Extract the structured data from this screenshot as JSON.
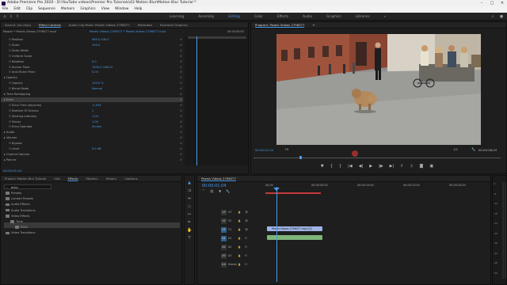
{
  "window": {
    "title": "Adobe Premiere Pro 2020 - D:\\YouTube videos\\Premier Pro Tutorials\\42 Motion Blur\\Motion Blur Tutorial *",
    "controls": [
      "–",
      "□",
      "✕"
    ]
  },
  "menu": [
    "File",
    "Edit",
    "Clip",
    "Sequence",
    "Markers",
    "Graphics",
    "View",
    "Window",
    "Help"
  ],
  "workspaces": {
    "tabs": [
      "Learning",
      "Assembly",
      "Editing",
      "Color",
      "Effects",
      "Audio",
      "Graphics",
      "Libraries"
    ],
    "active": "Editing",
    "more": "»"
  },
  "source_panel": {
    "tabs": [
      "Source: (no clips)",
      "Effect Controls",
      "Audio Clip Mixer: Pexels Videos 2796077",
      "Metadata",
      "Essential Graphics"
    ],
    "active_tab": "Effect Controls",
    "master_label": "Master * Pexels Videos 2796077.mp4",
    "clip_label": "Pexels Videos 2796077 * Pexels Videos 2796077.mp4",
    "ruler_time": "00:00:05:00",
    "rows": [
      {
        "label": "Position",
        "value": "960.0   540.0"
      },
      {
        "label": "Scale",
        "value": "100.0"
      },
      {
        "label": "Scale Width",
        "value": ""
      },
      {
        "label": "Uniform Scale",
        "value": ""
      },
      {
        "label": "Rotation",
        "value": "0.0"
      },
      {
        "label": "Anchor Point",
        "value": "1920.0   1080.0"
      },
      {
        "label": "Anti-flicker Filter",
        "value": "0.00"
      },
      {
        "label": "Opacity",
        "value": ""
      },
      {
        "label": "Opacity",
        "value": "100.0 %"
      },
      {
        "label": "Blend Mode",
        "value": "Normal"
      },
      {
        "label": "Time Remapping",
        "value": ""
      },
      {
        "label": "Echo",
        "value": ""
      },
      {
        "label": "Echo Time (seconds)",
        "value": "-0.033"
      },
      {
        "label": "Number Of Echoes",
        "value": "1"
      },
      {
        "label": "Starting Intensity",
        "value": "1.00"
      },
      {
        "label": "Decay",
        "value": "1.00"
      },
      {
        "label": "Echo Operator",
        "value": "Screen"
      },
      {
        "label": "Audio",
        "value": ""
      },
      {
        "label": "Volume",
        "value": ""
      },
      {
        "label": "Bypass",
        "value": ""
      },
      {
        "label": "Level",
        "value": "0.0 dB"
      },
      {
        "label": "Channel Volume",
        "value": ""
      },
      {
        "label": "Panner",
        "value": ""
      }
    ],
    "timecode": "00:00:01:04"
  },
  "program_monitor": {
    "title": "Program: Pexels Videos 2796077",
    "menu_icon": "≡",
    "timecode": "00:00:01:04",
    "fit": "Fit",
    "quality": "1/2",
    "duration": "00:00:06:03",
    "transport_icons": [
      "marker-icon",
      "in-point-icon",
      "out-point-icon",
      "go-to-in-icon",
      "step-back-icon",
      "play-icon",
      "step-forward-icon",
      "go-to-out-icon",
      "lift-icon",
      "extract-icon",
      "export-frame-icon",
      "compare-icon"
    ],
    "transport_glyphs": [
      "▼",
      "{",
      "}",
      "|◀",
      "◀|",
      "▶",
      "|▶",
      "▶|",
      "⇪",
      "⇩",
      "◙",
      "▣"
    ],
    "wrench_glyph": "🔧"
  },
  "project_panel": {
    "tabs": [
      "Project: Motion Blur Tutorial",
      "Info",
      "Effects",
      "Markers",
      "History",
      "Captions"
    ],
    "active_tab": "Effects",
    "search_value": "echo",
    "items": [
      {
        "label": "Presets",
        "indent": 0
      },
      {
        "label": "Lumetri Presets",
        "indent": 0
      },
      {
        "label": "Audio Effects",
        "indent": 0
      },
      {
        "label": "Audio Transitions",
        "indent": 0
      },
      {
        "label": "Video Effects",
        "indent": 0
      },
      {
        "label": "Time",
        "indent": 1
      },
      {
        "label": "Echo",
        "indent": 2
      },
      {
        "label": "Video Transitions",
        "indent": 0
      }
    ]
  },
  "timeline": {
    "tab": "Pexels Videos 2796077",
    "timecode": "00:00:01:04",
    "ruler": [
      "00:00",
      "00:00:05:00",
      "00:00:10:00",
      "00:00:15:00",
      "00:00:20:00"
    ],
    "tracks": [
      {
        "name": "V3",
        "target": "V3"
      },
      {
        "name": "V2",
        "target": "V2"
      },
      {
        "name": "V1",
        "target": "V1"
      },
      {
        "name": "A1",
        "target": "A1"
      },
      {
        "name": "A2",
        "target": "A2"
      },
      {
        "name": "A3",
        "target": "A3"
      },
      {
        "name": "Master",
        "target": "0.0"
      }
    ],
    "video_clip": "Pexels Videos 2796077.mp4 [V]",
    "audio_clip": "",
    "meter_scale": [
      "0",
      "-6",
      "-12",
      "-18",
      "-24",
      "-30",
      "-36",
      "-42",
      "-48",
      "-54"
    ]
  },
  "colors": {
    "accent_blue": "#4a9ae8",
    "video_clip": "#9fb5e8",
    "audio_clip": "#7fb57a",
    "playhead": "#4a9ae8",
    "work_area": "#c43a3a"
  }
}
